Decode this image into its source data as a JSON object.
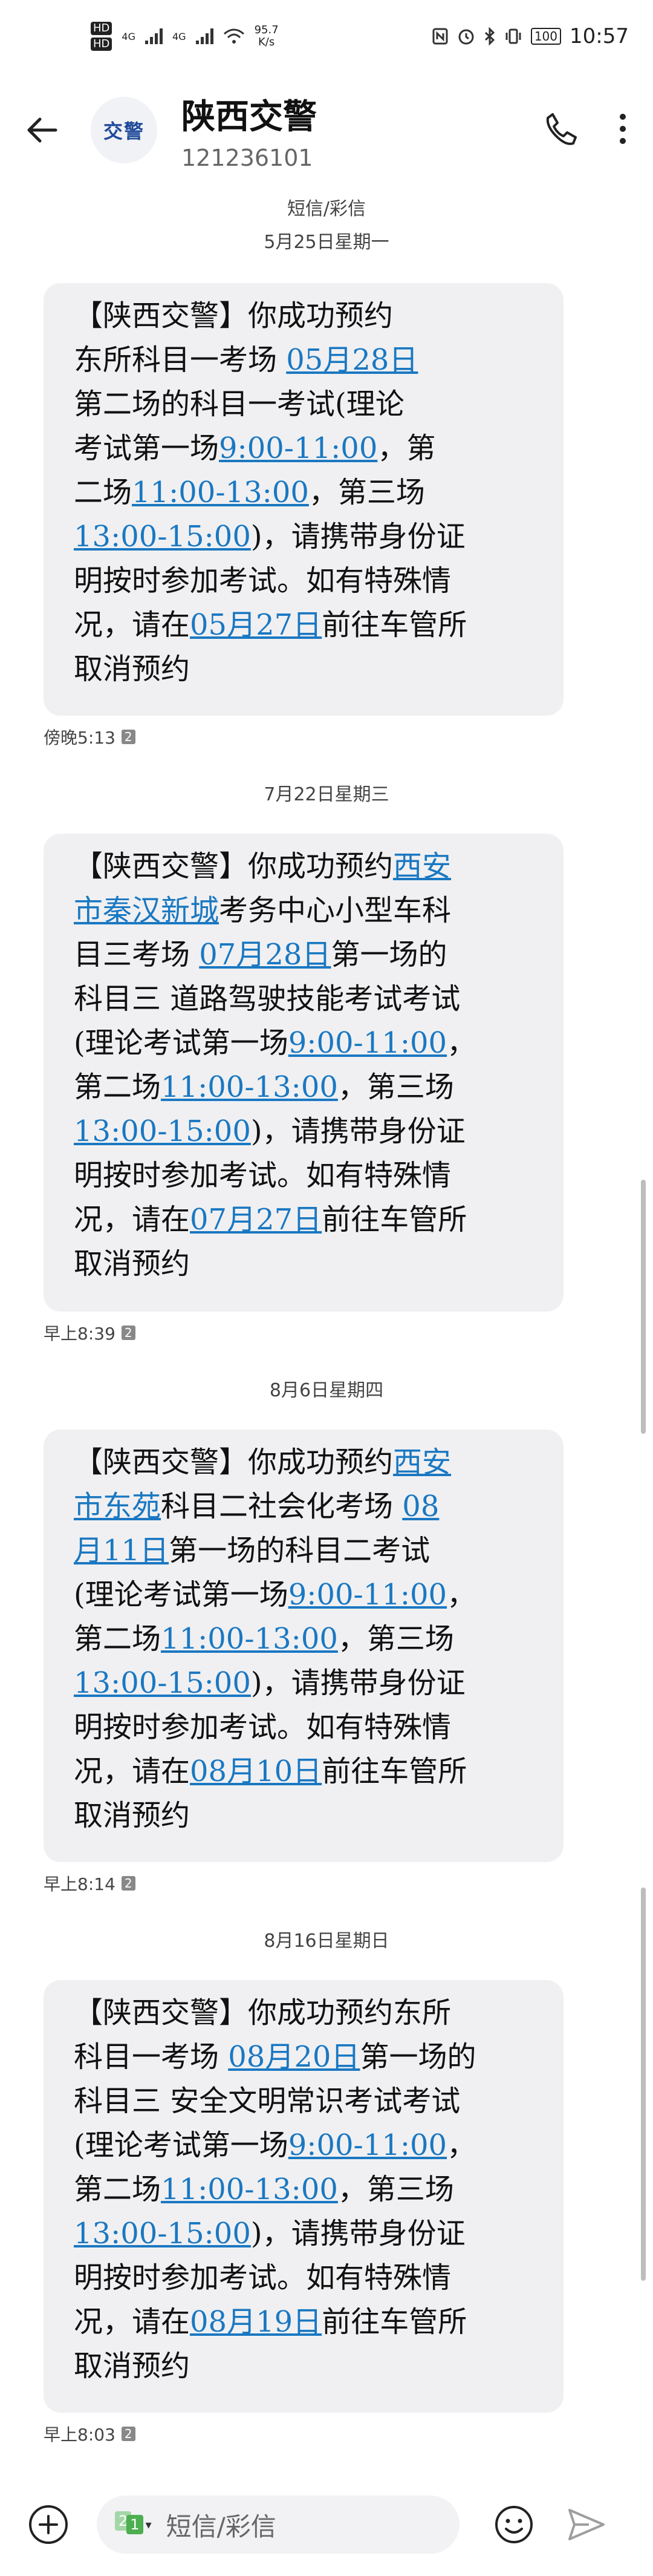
{
  "status": {
    "speed_value": "95.7",
    "speed_unit": "K/s",
    "battery": "100",
    "time": "10:57",
    "net1": "4G",
    "net2": "4G",
    "hd1": "HD",
    "hd2": "HD"
  },
  "header": {
    "title": "陕西交警",
    "number": "121236101",
    "avatar_text": "交警"
  },
  "thread": {
    "type_label": "短信/彩信",
    "messages": [
      {
        "date": "5月25日星期一",
        "lines": [
          [
            "【陕西交警】你成功预约"
          ],
          [
            "东所科目一考场 ",
            {
              "link": "05月28日"
            }
          ],
          [
            "第二场的科目一考试(理论"
          ],
          [
            "考试第一场",
            {
              "link": "9:00-11:00"
            },
            "，第"
          ],
          [
            "二场",
            {
              "link": "11:00-13:00"
            },
            "，第三场"
          ],
          [
            {
              "link": "13:00-15:00"
            },
            ")，请携带身份证"
          ],
          [
            "明按时参加考试。如有特殊情"
          ],
          [
            "况，请在",
            {
              "link": "05月27日"
            },
            "前往车管所"
          ],
          [
            "取消预约"
          ]
        ],
        "time": "傍晚5:13",
        "sim": "2"
      },
      {
        "date": "7月22日星期三",
        "lines": [
          [
            "【陕西交警】你成功预约",
            {
              "link": "西安"
            }
          ],
          [
            {
              "link": "市秦汉新城"
            },
            "考务中心小型车科"
          ],
          [
            "目三考场 ",
            {
              "link": "07月28日"
            },
            "第一场的"
          ],
          [
            "科目三 道路驾驶技能考试考试"
          ],
          [
            "(理论考试第一场",
            {
              "link": "9:00-11:00"
            },
            "，"
          ],
          [
            "第二场",
            {
              "link": "11:00-13:00"
            },
            "，第三场"
          ],
          [
            {
              "link": "13:00-15:00"
            },
            ")，请携带身份证"
          ],
          [
            "明按时参加考试。如有特殊情"
          ],
          [
            "况，请在",
            {
              "link": "07月27日"
            },
            "前往车管所"
          ],
          [
            "取消预约"
          ]
        ],
        "time": "早上8:39",
        "sim": "2"
      },
      {
        "date": "8月6日星期四",
        "lines": [
          [
            "【陕西交警】你成功预约",
            {
              "link": "西安"
            }
          ],
          [
            {
              "link": "市东苑"
            },
            "科目二社会化考场 ",
            {
              "link": "08"
            }
          ],
          [
            {
              "link": "月11日"
            },
            "第一场的科目二考试"
          ],
          [
            "(理论考试第一场",
            {
              "link": "9:00-11:00"
            },
            "，"
          ],
          [
            "第二场",
            {
              "link": "11:00-13:00"
            },
            "，第三场"
          ],
          [
            {
              "link": "13:00-15:00"
            },
            ")，请携带身份证"
          ],
          [
            "明按时参加考试。如有特殊情"
          ],
          [
            "况，请在",
            {
              "link": "08月10日"
            },
            "前往车管所"
          ],
          [
            "取消预约"
          ]
        ],
        "time": "早上8:14",
        "sim": "2"
      },
      {
        "date": "8月16日星期日",
        "lines": [
          [
            "【陕西交警】你成功预约东所"
          ],
          [
            "科目一考场 ",
            {
              "link": "08月20日"
            },
            "第一场的"
          ],
          [
            "科目三 安全文明常识考试考试"
          ],
          [
            "(理论考试第一场",
            {
              "link": "9:00-11:00"
            },
            "，"
          ],
          [
            "第二场",
            {
              "link": "11:00-13:00"
            },
            "，第三场"
          ],
          [
            {
              "link": "13:00-15:00"
            },
            ")，请携带身份证"
          ],
          [
            "明按时参加考试。如有特殊情"
          ],
          [
            "况，请在",
            {
              "link": "08月19日"
            },
            "前往车管所"
          ],
          [
            "取消预约"
          ]
        ],
        "time": "早上8:03",
        "sim": "2"
      }
    ]
  },
  "composer": {
    "placeholder": "短信/彩信",
    "sim_badge": "1",
    "sim_badge_back": "2"
  },
  "colors": {
    "link": "#1a78c2",
    "bubble": "#f0f0f2",
    "avatar_text": "#1f4a9a"
  },
  "icons": [
    "back-arrow-icon",
    "phone-icon",
    "more-icon",
    "add-icon",
    "emoji-icon",
    "send-icon"
  ]
}
